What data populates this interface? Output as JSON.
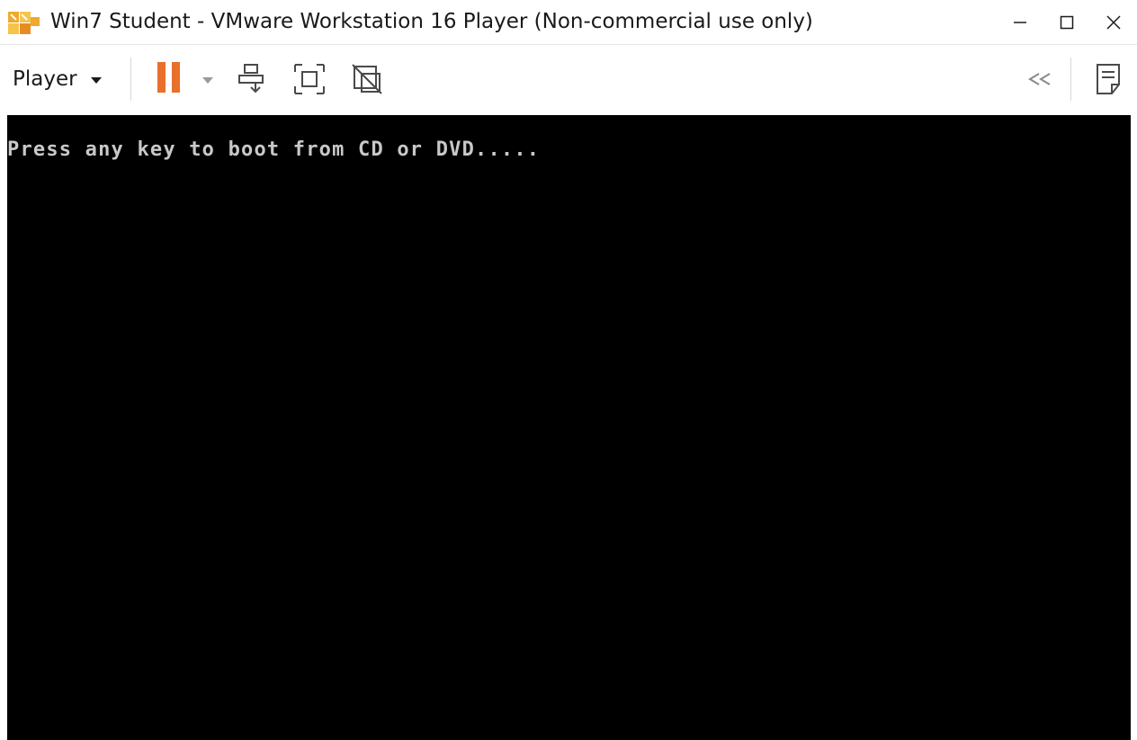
{
  "window": {
    "title": "Win7 Student - VMware Workstation 16 Player (Non-commercial use only)",
    "logo_icon": "vmware-logo-icon",
    "controls": {
      "minimize_icon": "minimize-icon",
      "maximize_icon": "maximize-icon",
      "close_icon": "close-icon"
    }
  },
  "toolbar": {
    "player_menu_label": "Player",
    "player_menu_icon": "chevron-down-icon",
    "buttons": [
      {
        "name": "pause",
        "icon": "pause-icon",
        "color": "#e8702a"
      },
      {
        "name": "power-options",
        "icon": "chevron-down-icon"
      },
      {
        "name": "send-ctrl-alt-del",
        "icon": "send-keys-icon"
      },
      {
        "name": "full-screen",
        "icon": "full-screen-icon"
      },
      {
        "name": "unity",
        "icon": "unity-icon"
      }
    ],
    "right_buttons": [
      {
        "name": "show-devices",
        "icon": "double-chevron-left-icon"
      },
      {
        "name": "message-log",
        "icon": "message-log-icon"
      }
    ]
  },
  "vm": {
    "console_text": "Press any key to boot from CD or DVD.....",
    "background": "#000000",
    "text_color": "#c8c8c8"
  }
}
